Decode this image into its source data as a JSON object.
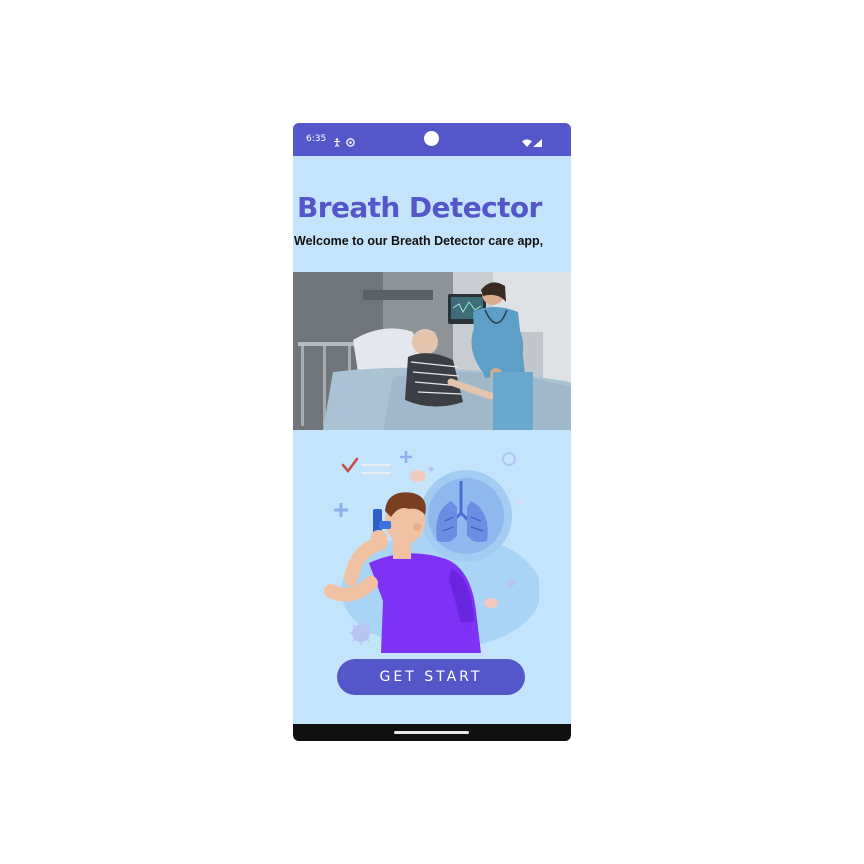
{
  "status_bar": {
    "time": "6:35",
    "icons": [
      "accessibility-icon",
      "location-icon",
      "wifi-icon",
      "signal-icon"
    ]
  },
  "app": {
    "title": "Breath Detector",
    "welcome_text": "Welcome to our Breath Detector care app,",
    "cta_label": "GET START"
  },
  "images": {
    "photo": "hospital-photo",
    "illustration": "inhaler-illustration"
  },
  "colors": {
    "primary": "#5457c9",
    "background": "#c4e4fb",
    "nav_bar": "#101010"
  }
}
